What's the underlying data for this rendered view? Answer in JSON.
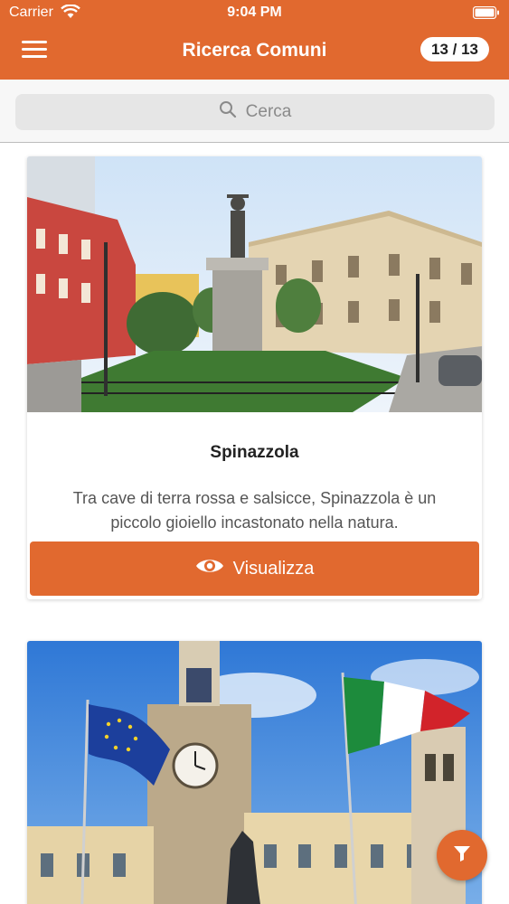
{
  "status_bar": {
    "carrier": "Carrier",
    "time": "9:04 PM"
  },
  "header": {
    "title": "Ricerca Comuni",
    "counter": "13 / 13",
    "menu_icon": "hamburger-menu-icon"
  },
  "search": {
    "placeholder": "Cerca",
    "icon": "search-icon"
  },
  "cards": [
    {
      "title": "Spinazzola",
      "description": "Tra cave di terra rossa e salsicce, Spinazzola è un piccolo gioiello incastonato nella natura.",
      "button_label": "Visualizza",
      "button_icon": "eye-icon"
    },
    {
      "image": "town-hall-clock-tower-flags-photo"
    }
  ],
  "fab": {
    "icon": "filter-icon"
  },
  "colors": {
    "accent": "#e1692f",
    "search_bg": "#e6e6e6"
  }
}
